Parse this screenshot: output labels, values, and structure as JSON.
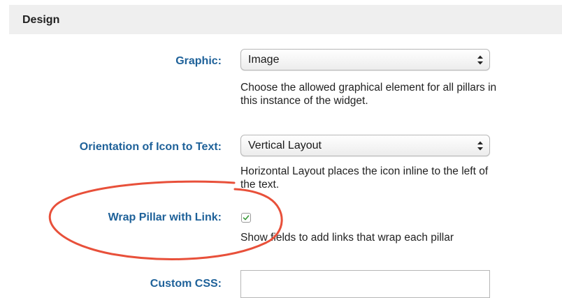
{
  "section": {
    "title": "Design"
  },
  "fields": {
    "graphic": {
      "label": "Graphic:",
      "value": "Image",
      "help": "Choose the allowed graphical element for all pillars in this instance of the widget."
    },
    "orientation": {
      "label": "Orientation of Icon to Text:",
      "value": "Vertical Layout",
      "help": "Horizontal Layout places the icon inline to the left of the text."
    },
    "wrap_link": {
      "label": "Wrap Pillar with Link:",
      "checked": true,
      "help": "Show fields to add links that wrap each pillar"
    },
    "custom_css": {
      "label": "Custom CSS:",
      "value": ""
    }
  },
  "colors": {
    "label": "#1e6199",
    "annotation": "#e8503a",
    "checkmark": "#3a9a3a",
    "header_bg": "#efefef"
  },
  "icons": {
    "select_arrows": "up-down-chevron-icon",
    "checkmark": "checkmark-icon"
  }
}
